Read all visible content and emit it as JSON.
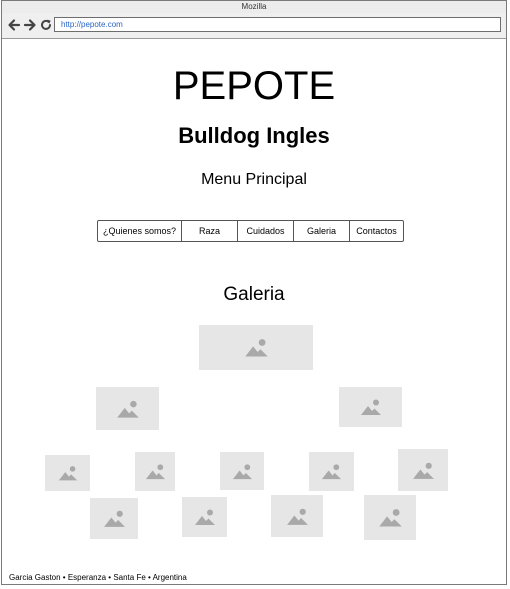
{
  "browser": {
    "window_title": "Mozilla",
    "url": "http://pepote.com",
    "icons": [
      "back-arrow-icon",
      "forward-arrow-icon",
      "reload-icon"
    ]
  },
  "header": {
    "title": "PEPOTE",
    "subtitle": "Bulldog Ingles"
  },
  "menu": {
    "heading": "Menu Principal",
    "items": [
      {
        "label": "¿Quienes somos?"
      },
      {
        "label": "Raza"
      },
      {
        "label": "Cuidados"
      },
      {
        "label": "Galeria"
      },
      {
        "label": "Contactos"
      }
    ]
  },
  "gallery": {
    "heading": "Galeria",
    "image_count": 12,
    "image_icon": "image-placeholder-icon",
    "placeholder_color": "#e6e6e6"
  },
  "footer": {
    "text": "Garcia Gaston • Esperanza • Santa Fe • Argentina"
  }
}
